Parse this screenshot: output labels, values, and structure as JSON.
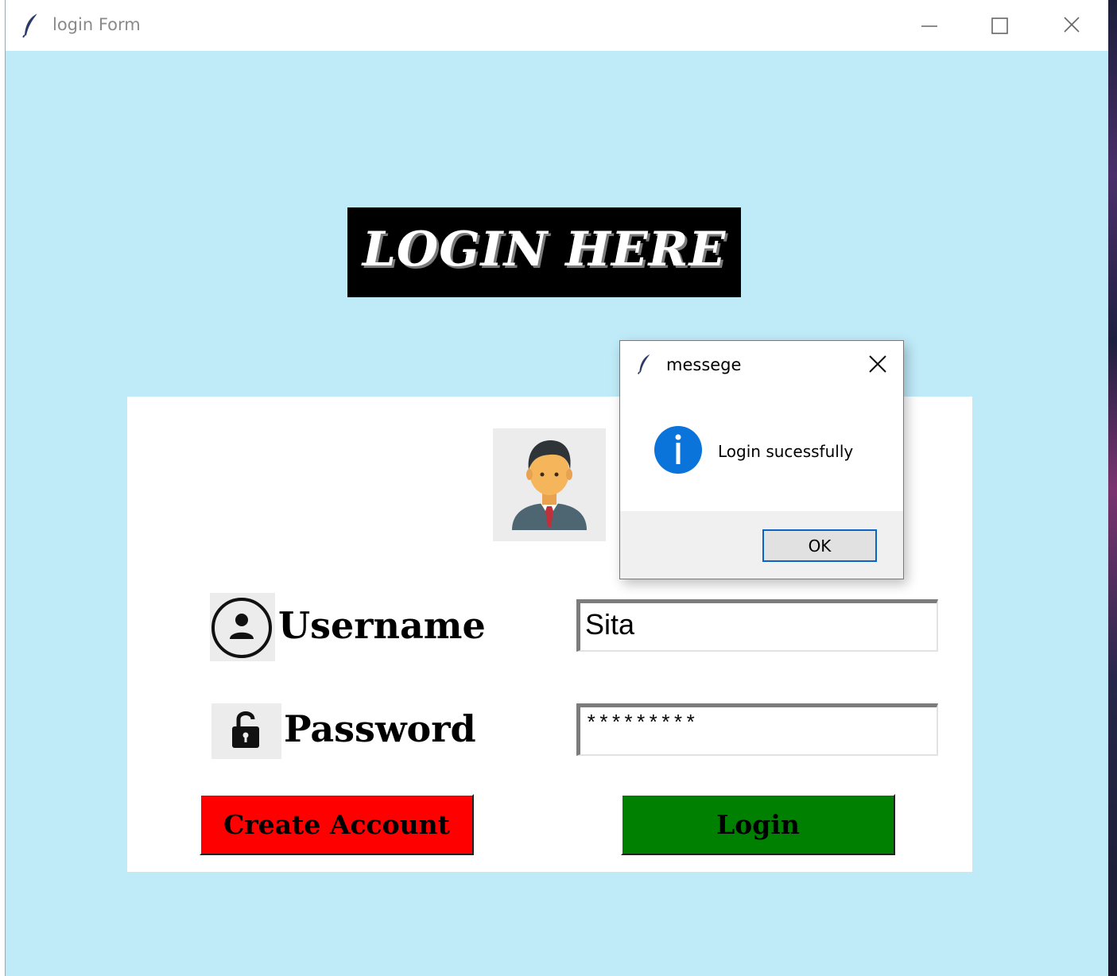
{
  "window": {
    "title": "login Form"
  },
  "banner": {
    "text": "LOGIN HERE"
  },
  "form": {
    "username_label": "Username",
    "password_label": "Password",
    "username_value": "Sita",
    "password_value": "*********",
    "create_account_label": "Create Account",
    "login_label": "Login"
  },
  "dialog": {
    "title": "messege",
    "message": "Login sucessfully",
    "ok_label": "OK"
  },
  "colors": {
    "background": "#bfeaf8",
    "create_account_button": "#ff0000",
    "login_button": "#008000",
    "banner_background": "#000000",
    "info_icon": "#0a74da"
  },
  "icons": {
    "app": "feather-icon",
    "user_row": "user-circle-icon",
    "password_row": "padlock-icon",
    "avatar": "businessman-avatar-icon",
    "dialog": "info-icon"
  }
}
